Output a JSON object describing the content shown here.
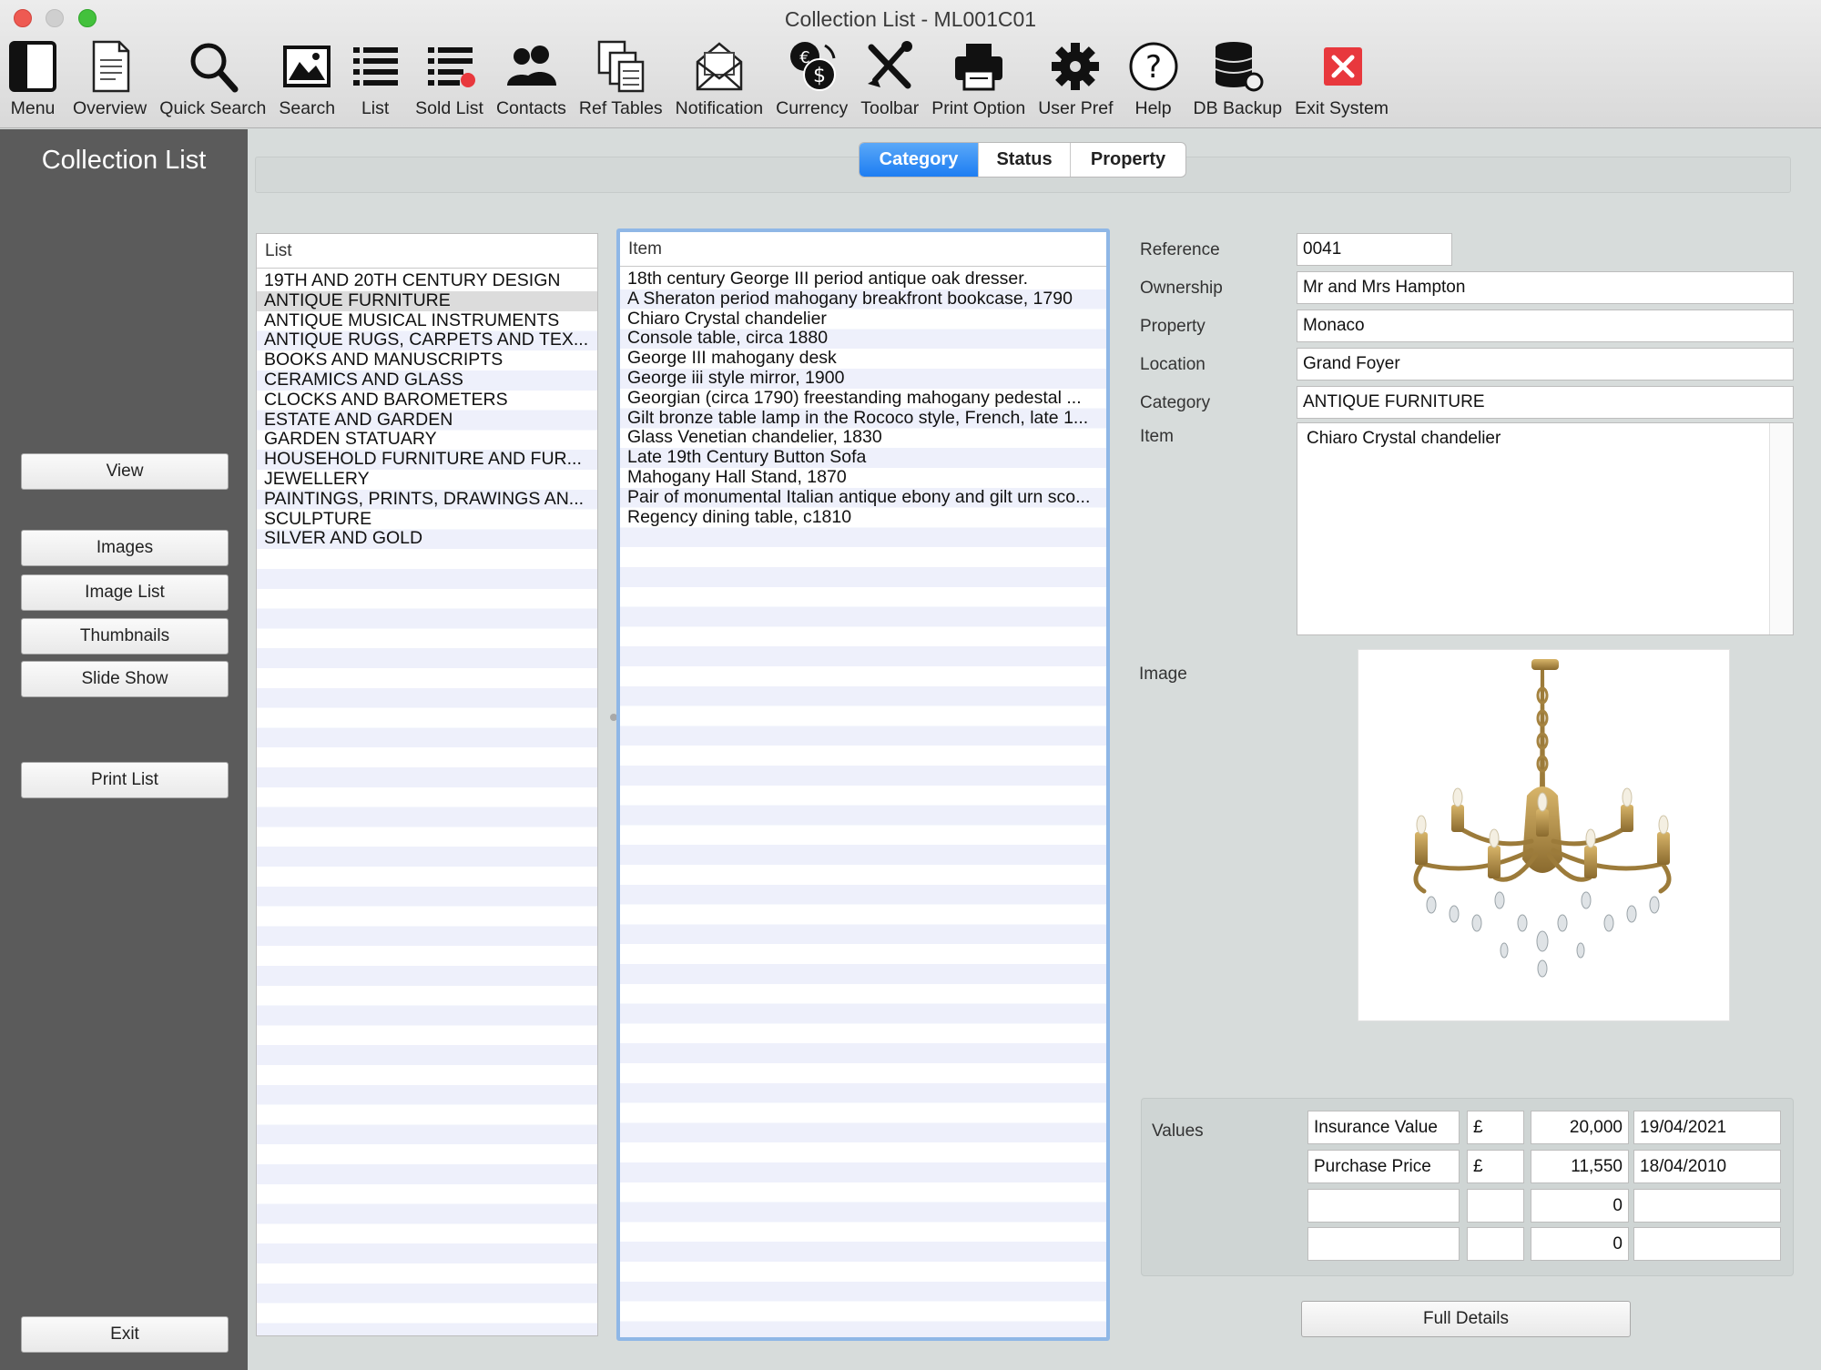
{
  "window": {
    "title": "Collection List - ML001C01"
  },
  "toolbar": [
    {
      "label": "Menu",
      "icon": "menu-icon"
    },
    {
      "label": "Overview",
      "icon": "document-icon"
    },
    {
      "label": "Quick Search",
      "icon": "magnifier-icon"
    },
    {
      "label": "Search",
      "icon": "picture-icon"
    },
    {
      "label": "List",
      "icon": "list-icon"
    },
    {
      "label": "Sold List",
      "icon": "sold-list-icon"
    },
    {
      "label": "Contacts",
      "icon": "people-icon"
    },
    {
      "label": "Ref Tables",
      "icon": "tables-icon"
    },
    {
      "label": "Notification",
      "icon": "envelope-icon"
    },
    {
      "label": "Currency",
      "icon": "currency-icon"
    },
    {
      "label": "Toolbar",
      "icon": "tools-icon"
    },
    {
      "label": "Print Option",
      "icon": "printer-icon"
    },
    {
      "label": "User Pref",
      "icon": "gear-icon"
    },
    {
      "label": "Help",
      "icon": "help-icon"
    },
    {
      "label": "DB Backup",
      "icon": "database-icon"
    },
    {
      "label": "Exit System",
      "icon": "exit-icon"
    }
  ],
  "sidebar": {
    "title": "Collection List",
    "buttons": {
      "view": "View",
      "images": "Images",
      "image_list": "Image List",
      "thumbnails": "Thumbnails",
      "slide_show": "Slide Show",
      "print_list": "Print List",
      "exit": "Exit"
    }
  },
  "tabs": {
    "category": "Category",
    "status": "Status",
    "property": "Property",
    "active": "Category"
  },
  "list_panel": {
    "header": "List",
    "items": [
      "19TH AND 20TH CENTURY DESIGN",
      "ANTIQUE FURNITURE",
      "ANTIQUE MUSICAL INSTRUMENTS",
      "ANTIQUE RUGS, CARPETS AND TEX...",
      "BOOKS AND MANUSCRIPTS",
      "CERAMICS AND GLASS",
      "CLOCKS AND BAROMETERS",
      "ESTATE AND GARDEN",
      "GARDEN STATUARY",
      "HOUSEHOLD FURNITURE AND FUR...",
      "JEWELLERY",
      "PAINTINGS, PRINTS, DRAWINGS AN...",
      "SCULPTURE",
      "SILVER AND GOLD"
    ],
    "selected_index": 1
  },
  "item_panel": {
    "header": "Item",
    "items": [
      "18th century George III period antique oak dresser.",
      "A Sheraton period mahogany breakfront bookcase, 1790",
      "Chiaro Crystal chandelier",
      "Console table, circa 1880",
      "George III mahogany desk",
      "George iii style mirror, 1900",
      "Georgian (circa 1790) freestanding mahogany pedestal ...",
      "Gilt bronze table lamp in the Rococo style, French, late 1...",
      "Glass Venetian chandelier, 1830",
      "Late 19th Century Button Sofa",
      "Mahogany Hall Stand, 1870",
      "Pair of monumental Italian antique ebony and gilt urn sco...",
      "Regency dining table, c1810"
    ]
  },
  "details": {
    "reference_label": "Reference",
    "reference": "0041",
    "ownership_label": "Ownership",
    "ownership": "Mr and Mrs Hampton",
    "property_label": "Property",
    "property": "Monaco",
    "location_label": "Location",
    "location": "Grand Foyer",
    "category_label": "Category",
    "category": "ANTIQUE FURNITURE",
    "item_label": "Item",
    "item": "Chiaro Crystal chandelier",
    "image_label": "Image"
  },
  "values": {
    "label": "Values",
    "rows": [
      {
        "type": "Insurance Value",
        "currency": "£",
        "amount": "20,000",
        "date": "19/04/2021"
      },
      {
        "type": "Purchase Price",
        "currency": "£",
        "amount": "11,550",
        "date": "18/04/2010"
      },
      {
        "type": "",
        "currency": "",
        "amount": "0",
        "date": ""
      },
      {
        "type": "",
        "currency": "",
        "amount": "0",
        "date": ""
      }
    ]
  },
  "full_details_label": "Full Details",
  "colors": {
    "accent": "#1d7df2",
    "sidebar": "#5b5b5b",
    "exit": "#e8383d"
  }
}
